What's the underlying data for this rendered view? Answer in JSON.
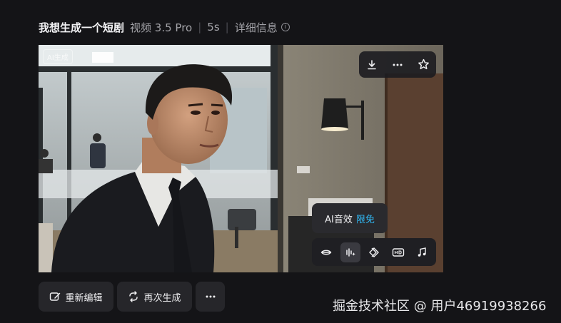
{
  "header": {
    "title": "我想生成一个短剧",
    "model": "视频 3.5 Pro",
    "separator": "|",
    "duration": "5s",
    "details_label": "详细信息",
    "info_icon": "info-icon"
  },
  "video": {
    "ai_badge": "AI生成",
    "top_tools": [
      "download-icon",
      "more-horizontal-icon",
      "star-icon"
    ]
  },
  "tooltip": {
    "label": "AI音效",
    "tag": "限免",
    "tag_color": "#30b8f4"
  },
  "tool_bar": {
    "items": [
      "lip-sync-icon",
      "ai-sound-effect-icon",
      "diamond-icon",
      "hd-icon",
      "music-note-icon"
    ],
    "active_index": 1
  },
  "actions": {
    "reedit_label": "重新编辑",
    "regenerate_label": "再次生成",
    "more_icon": "more-horizontal-icon"
  },
  "watermark": "掘金技术社区 @ 用户46919938266"
}
